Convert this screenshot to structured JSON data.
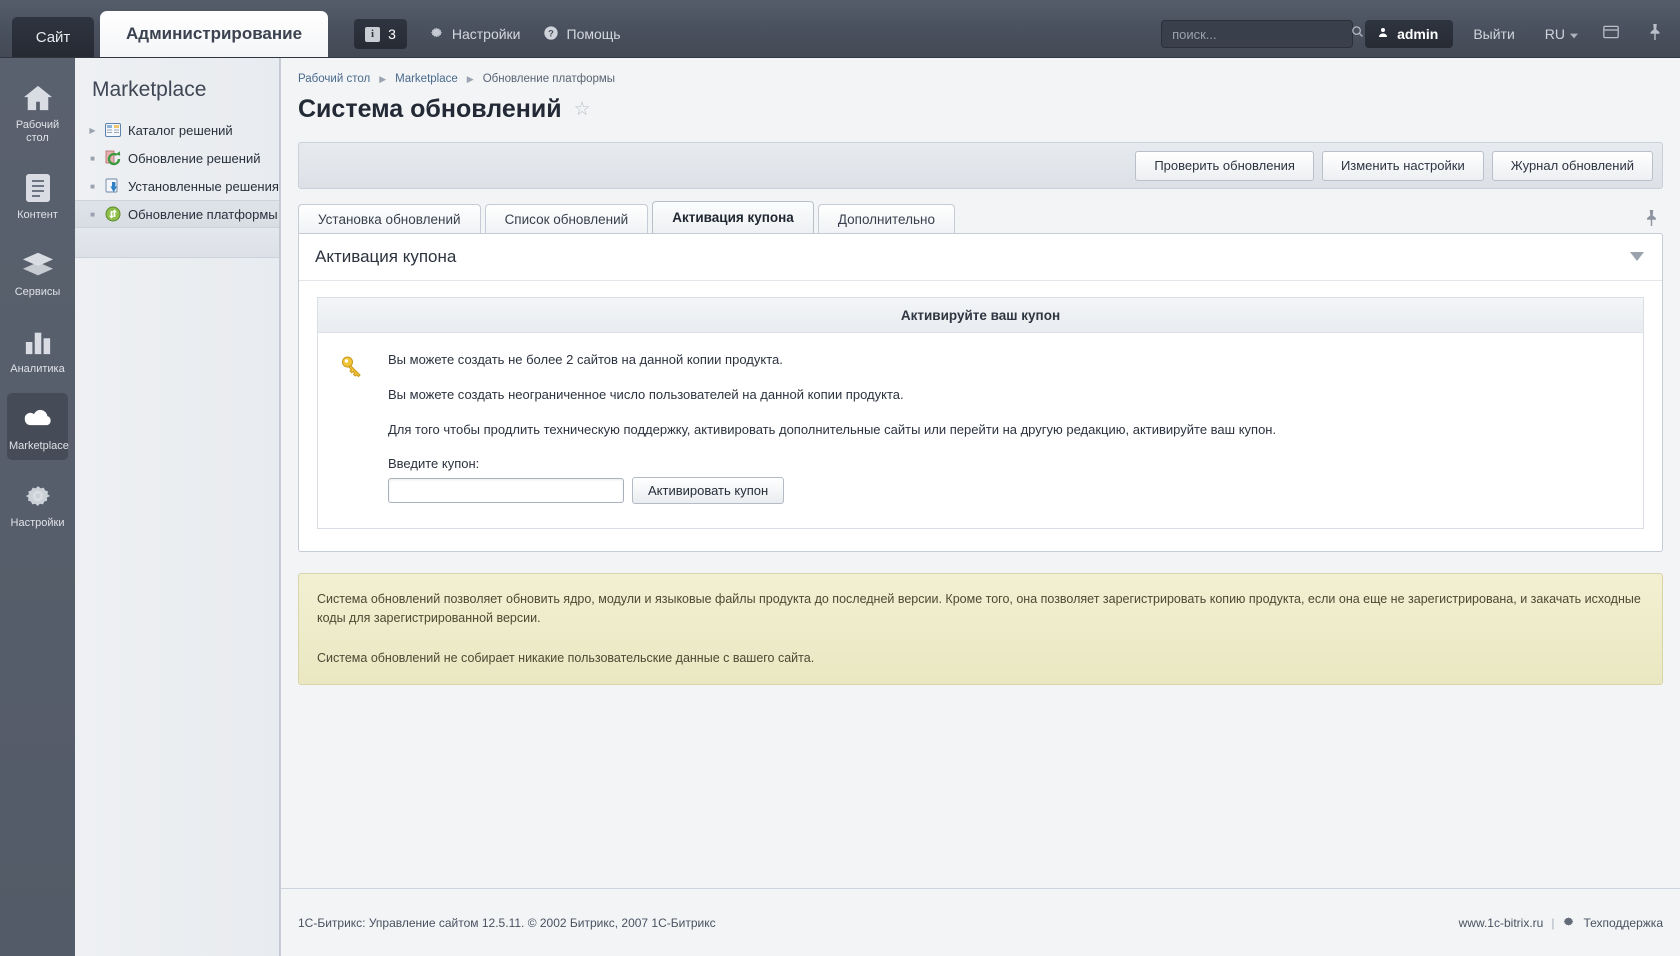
{
  "topbar": {
    "site_tab": "Сайт",
    "admin_tab": "Администрирование",
    "counter_icon": "info-icon",
    "counter_value": "3",
    "settings_label": "Настройки",
    "settings_icon": "gear-icon",
    "help_label": "Помощь",
    "help_icon": "question-icon",
    "search_placeholder": "поиск...",
    "search_value": "",
    "search_icon": "search-icon",
    "user_label": "admin",
    "user_icon": "user-icon",
    "logout_label": "Выйти",
    "lang_label": "RU",
    "lang_caret": "chevron-down-icon",
    "panel_icon": "panel-icon",
    "pin_icon": "pin-icon"
  },
  "rail": {
    "items": [
      {
        "label": "Рабочий стол",
        "icon": "home-icon",
        "active": false
      },
      {
        "label": "Контент",
        "icon": "document-icon",
        "active": false
      },
      {
        "label": "Сервисы",
        "icon": "layers-icon",
        "active": false
      },
      {
        "label": "Аналитика",
        "icon": "bar-chart-icon",
        "active": false
      },
      {
        "label": "Marketplace",
        "icon": "cloud-download-icon",
        "active": true
      },
      {
        "label": "Настройки",
        "icon": "gear-icon",
        "active": false
      }
    ]
  },
  "sidebar": {
    "title": "Marketplace",
    "items": [
      {
        "label": "Каталог решений",
        "icon": "catalog-icon",
        "bullet": "triangle",
        "active": false
      },
      {
        "label": "Обновление решений",
        "icon": "refresh-icon",
        "bullet": "square",
        "active": false
      },
      {
        "label": "Установленные решения",
        "icon": "install-icon",
        "bullet": "square",
        "active": false
      },
      {
        "label": "Обновление платформы",
        "icon": "update-icon",
        "bullet": "square",
        "active": true
      }
    ]
  },
  "breadcrumb": {
    "items": [
      "Рабочий стол",
      "Marketplace",
      "Обновление платформы"
    ],
    "separator_icon": "chevron-right-icon"
  },
  "page": {
    "title": "Система обновлений",
    "favorite_icon": "star-icon"
  },
  "toolbar": {
    "buttons": [
      "Проверить обновления",
      "Изменить настройки",
      "Журнал обновлений"
    ]
  },
  "tabs": {
    "items": [
      {
        "label": "Установка обновлений",
        "active": false
      },
      {
        "label": "Список обновлений",
        "active": false
      },
      {
        "label": "Активация купона",
        "active": true
      },
      {
        "label": "Дополнительно",
        "active": false
      }
    ],
    "pin_icon": "pin-icon"
  },
  "panel": {
    "title": "Активация купона",
    "collapse_icon": "chevron-down-icon",
    "inner_header": "Активируйте ваш купон",
    "key_icon": "key-icon",
    "paragraphs": [
      "Вы можете создать не более 2 сайтов на данной копии продукта.",
      "Вы можете создать неограниченное число пользователей на данной копии продукта.",
      "Для того чтобы продлить техническую поддержку, активировать дополнительные сайты или перейти на другую редакцию, активируйте ваш купон."
    ],
    "field_label": "Введите купон:",
    "field_value": "",
    "field_placeholder": "",
    "submit_label": "Активировать купон"
  },
  "notice": {
    "paragraph_1": "Система обновлений позволяет обновить ядро, модули и языковые файлы продукта до последней версии. Кроме того, она позволяет зарегистрировать копию продукта, если она еще не зарегистрирована, и закачать исходные коды для зарегистрированной версии.",
    "paragraph_2": "Система обновлений не собирает никакие пользовательские данные с вашего сайта."
  },
  "footer": {
    "copyright": "1С-Битрикс: Управление сайтом 12.5.11. © 2002 Битрикс, 2007 1С-Битрикс",
    "site_link": "www.1c-bitrix.ru",
    "separator": "|",
    "support_icon": "gear-icon",
    "support_label": "Техподдержка"
  },
  "colors": {
    "topbar_bg": "#4a515e",
    "rail_bg": "#575e6b",
    "accent_blue": "#4a6a8c",
    "notice_bg": "#eae7c2",
    "panel_bg": "#ffffff"
  }
}
